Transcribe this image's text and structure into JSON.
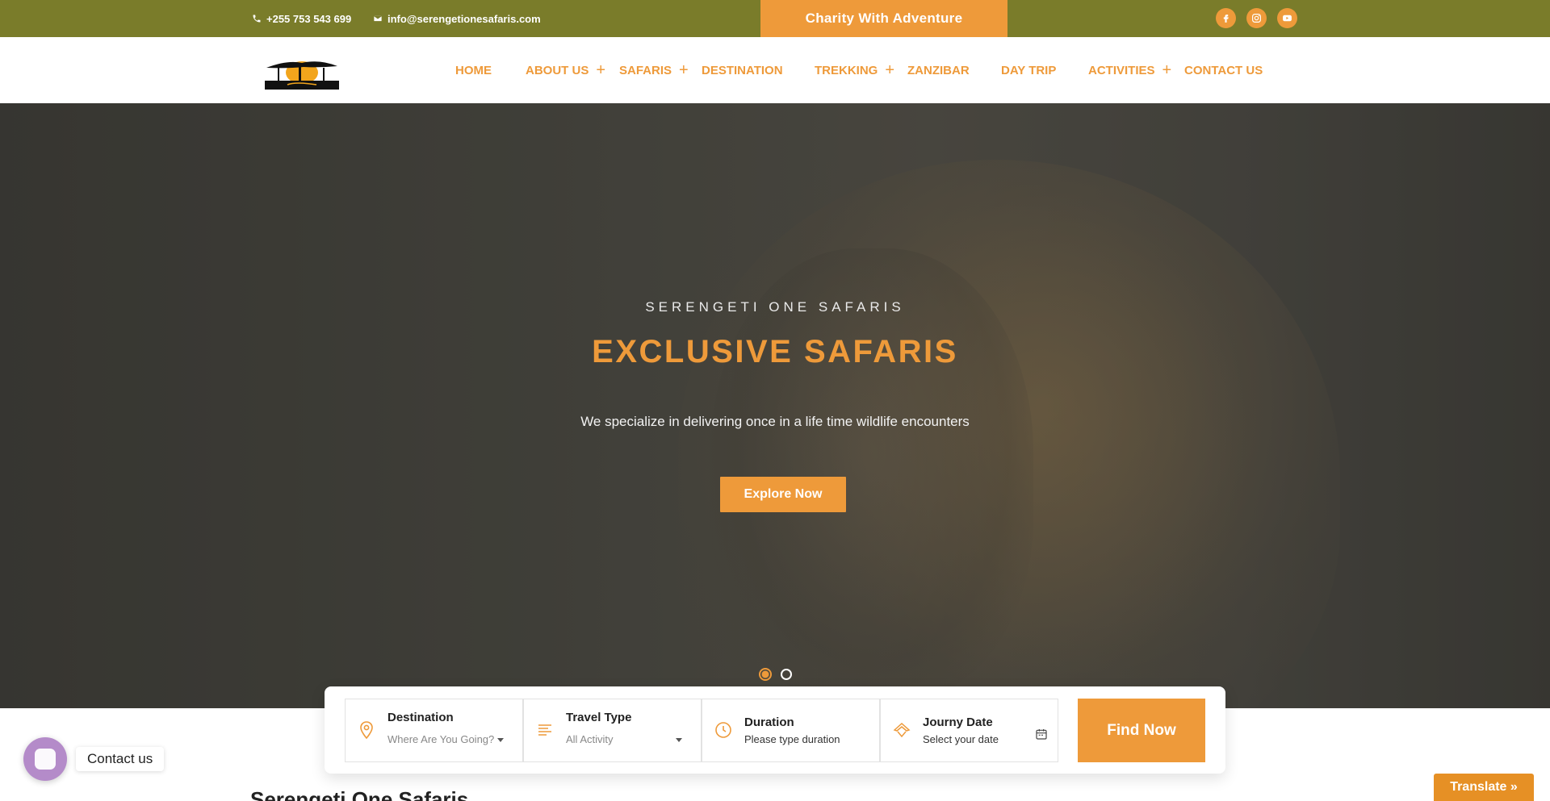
{
  "topbar": {
    "phone": "+255 753 543 699",
    "email": "info@serengetionesafaris.com",
    "charity_button": "Charity With Adventure",
    "social": [
      "facebook-icon",
      "instagram-icon",
      "youtube-icon"
    ]
  },
  "nav": {
    "items": [
      {
        "label": "HOME",
        "has_submenu": false
      },
      {
        "label": "ABOUT US",
        "has_submenu": true
      },
      {
        "label": "SAFARIS",
        "has_submenu": true
      },
      {
        "label": "DESTINATION",
        "has_submenu": false
      },
      {
        "label": "TREKKING",
        "has_submenu": true
      },
      {
        "label": "ZANZIBAR",
        "has_submenu": false
      },
      {
        "label": "DAY TRIP",
        "has_submenu": false
      },
      {
        "label": "ACTIVITIES",
        "has_submenu": true
      },
      {
        "label": "CONTACT US",
        "has_submenu": false
      }
    ],
    "submenu_icon": "+"
  },
  "hero": {
    "eyebrow": "SERENGETI ONE SAFARIS",
    "headline": "EXCLUSIVE SAFARIS",
    "tagline": "We specialize in delivering once in a life time wildlife encounters",
    "cta": "Explore Now",
    "slides_total": 2,
    "active_slide": 1
  },
  "search": {
    "destination": {
      "label": "Destination",
      "placeholder": "Where Are You Going?"
    },
    "travel_type": {
      "label": "Travel Type",
      "value": "All Activity"
    },
    "duration": {
      "label": "Duration",
      "placeholder": "Please type duration"
    },
    "date": {
      "label": "Journy Date",
      "placeholder": "Select your date"
    },
    "submit": "Find Now"
  },
  "section": {
    "title": "Serengeti One Safaris"
  },
  "contact_widget": {
    "label": "Contact us"
  },
  "translate": {
    "label": "Translate »"
  },
  "colors": {
    "accent": "#ee9a3a",
    "topbar": "#7a7c2a",
    "chat": "#b48bc9"
  }
}
